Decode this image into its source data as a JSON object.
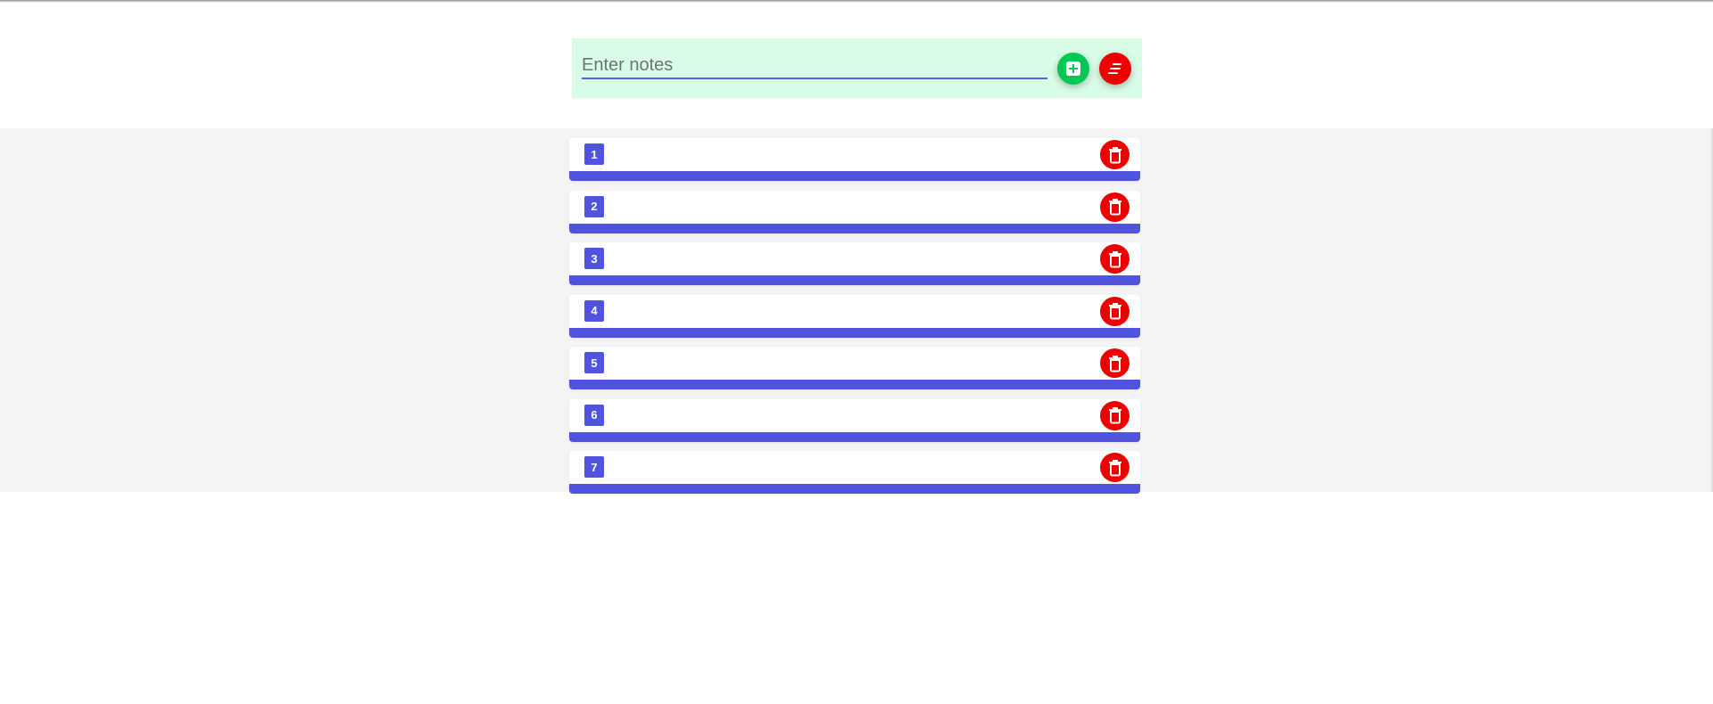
{
  "input": {
    "placeholder": "Enter notes",
    "value": ""
  },
  "buttons": {
    "add_icon": "plus-square-icon",
    "clear_icon": "clear-list-icon",
    "delete_icon": "trash-icon"
  },
  "notes": [
    {
      "number": "1",
      "text": ""
    },
    {
      "number": "2",
      "text": ""
    },
    {
      "number": "3",
      "text": ""
    },
    {
      "number": "4",
      "text": ""
    },
    {
      "number": "5",
      "text": ""
    },
    {
      "number": "6",
      "text": ""
    },
    {
      "number": "7",
      "text": ""
    }
  ],
  "colors": {
    "accent": "#4f53de",
    "add": "#00c853",
    "danger": "#ef0000",
    "panel": "#d8fce6",
    "list_background": "#f4f4f4"
  }
}
